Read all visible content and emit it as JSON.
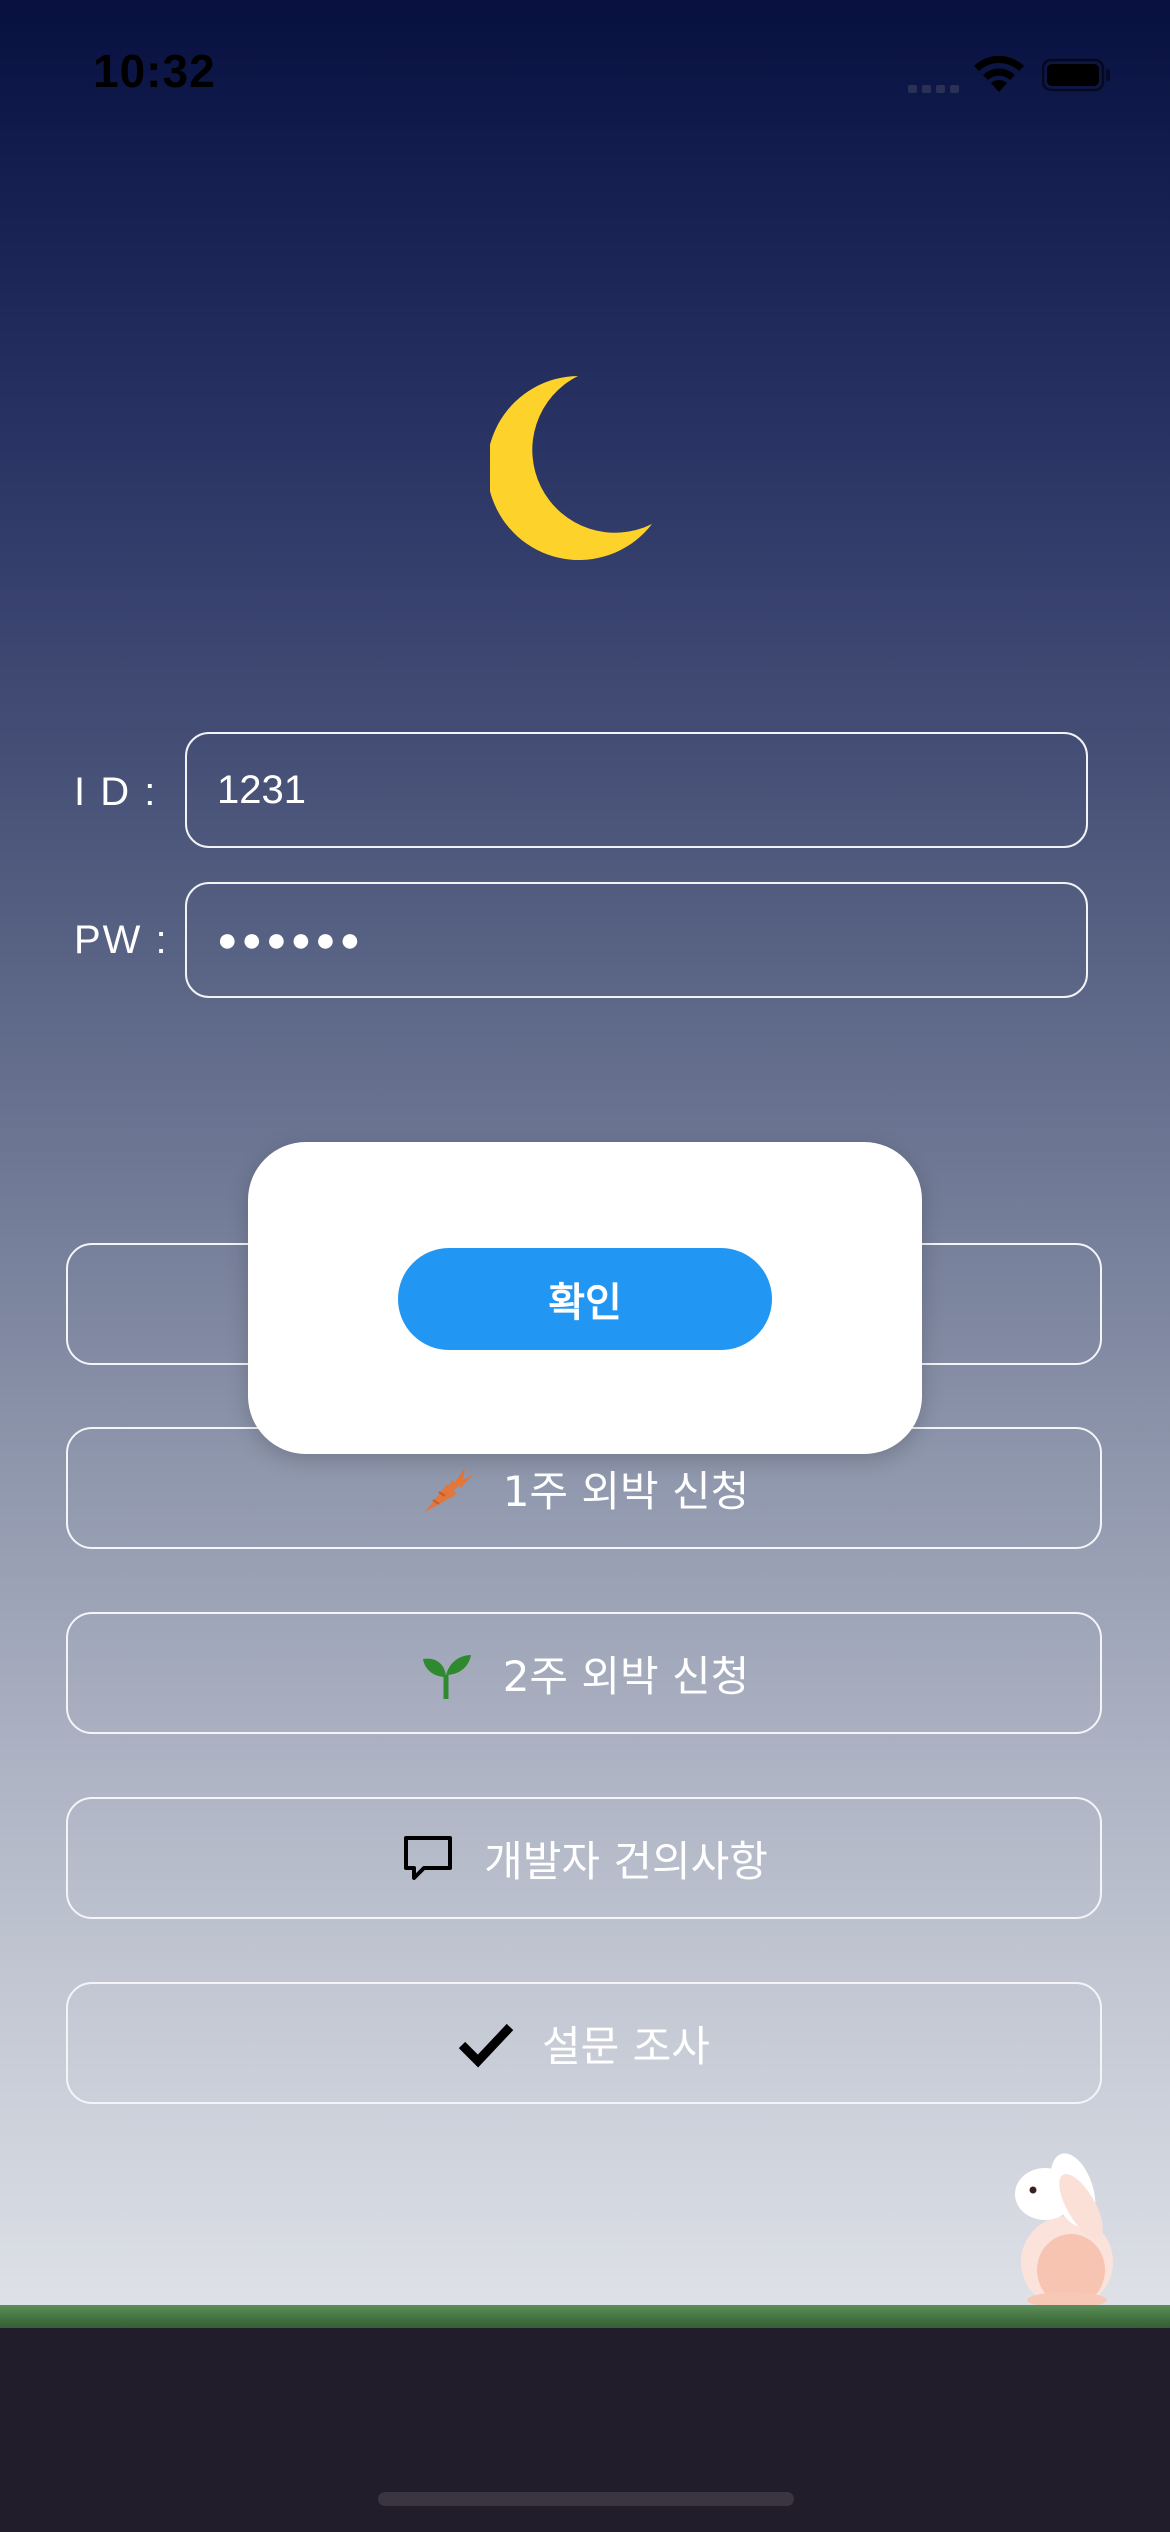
{
  "status_bar": {
    "time": "10:32"
  },
  "form": {
    "id_label": "I D :",
    "id_value": "1231",
    "pw_label": "PW :",
    "pw_value": "●●●●●●"
  },
  "popup": {
    "confirm_label": "확인"
  },
  "menu": {
    "items": [
      {
        "label": "",
        "icon": ""
      },
      {
        "label": "1주 외박 신청",
        "icon": "carrot-icon"
      },
      {
        "label": "2주 외박 신청",
        "icon": "sprout-icon"
      },
      {
        "label": "개발자 건의사항",
        "icon": "chat-bubble-icon"
      },
      {
        "label": "설문 조사",
        "icon": "checkmark-icon"
      }
    ]
  },
  "colors": {
    "moon": "#fdd22b",
    "confirm_button": "#2196f3",
    "carrot": "#e2763b",
    "sprout": "#2f8a2f",
    "ground": "#221d2b",
    "grass": "#4f7f4a"
  }
}
